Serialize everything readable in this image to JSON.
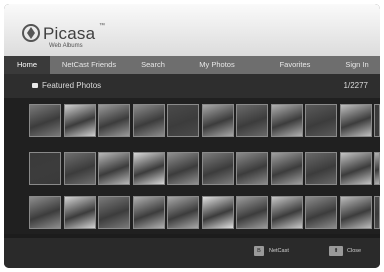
{
  "app": {
    "name": "Picasa",
    "trademark": "™",
    "subtitle": "Web Albums"
  },
  "nav": {
    "tabs": [
      {
        "id": "home",
        "label": "Home",
        "active": true
      },
      {
        "id": "netcast-friends",
        "label": "NetCast Friends",
        "active": false
      },
      {
        "id": "search",
        "label": "Search",
        "active": false
      },
      {
        "id": "my-photos",
        "label": "My Photos",
        "active": false
      },
      {
        "id": "favorites",
        "label": "Favorites",
        "active": false
      },
      {
        "id": "sign-in",
        "label": "Sign In",
        "active": false
      }
    ]
  },
  "section": {
    "title": "Featured Photos",
    "counter": "1/2277"
  },
  "footer": {
    "netcast_key": "B",
    "netcast_label": "NetCast",
    "close_key": "⬆",
    "close_label": "Close"
  },
  "photos": {
    "rows": [
      [
        {
          "name": "photo-wolf",
          "tone": "#7a7a7a"
        },
        {
          "name": "photo-leaf",
          "tone": "#d0d0d0"
        },
        {
          "name": "photo-hands",
          "tone": "#9a9a9a"
        },
        {
          "name": "photo-tree-silhouette",
          "tone": "#8c8c8c"
        },
        {
          "name": "photo-portrait-boy",
          "tone": "#4a4a4a"
        },
        {
          "name": "photo-pattern",
          "tone": "#a8a8a8"
        },
        {
          "name": "photo-flowers",
          "tone": "#6a6a6a"
        },
        {
          "name": "photo-landscape",
          "tone": "#b0b0b0"
        },
        {
          "name": "photo-forest",
          "tone": "#5a5a5a"
        },
        {
          "name": "photo-white-plant",
          "tone": "#c0c0c0"
        },
        {
          "name": "photo-edge-dark",
          "tone": "#3a3a3a"
        }
      ],
      [
        {
          "name": "photo-dark-wood",
          "tone": "#3a3a3a"
        },
        {
          "name": "photo-woman-portrait",
          "tone": "#6e6e6e"
        },
        {
          "name": "photo-beach",
          "tone": "#b8b8b8"
        },
        {
          "name": "photo-dancer",
          "tone": "#d8d8d8"
        },
        {
          "name": "photo-rocks",
          "tone": "#909090"
        },
        {
          "name": "photo-crowd",
          "tone": "#7c7c7c"
        },
        {
          "name": "photo-street",
          "tone": "#8a8a8a"
        },
        {
          "name": "photo-branches",
          "tone": "#a0a0a0"
        },
        {
          "name": "photo-grass",
          "tone": "#686868"
        },
        {
          "name": "photo-fog",
          "tone": "#c4c4c4"
        },
        {
          "name": "photo-edge-light",
          "tone": "#b4b4b4"
        }
      ],
      [
        {
          "name": "photo-gray-wall",
          "tone": "#8e8e8e"
        },
        {
          "name": "photo-snow-field",
          "tone": "#d4d4d4"
        },
        {
          "name": "photo-seal",
          "tone": "#7a7a7a"
        },
        {
          "name": "photo-animal",
          "tone": "#b0b0b0"
        },
        {
          "name": "photo-shore",
          "tone": "#a8a8a8"
        },
        {
          "name": "photo-wave",
          "tone": "#e0e0e0"
        },
        {
          "name": "photo-hills",
          "tone": "#9c9c9c"
        },
        {
          "name": "photo-tree-spiral",
          "tone": "#c8c8c8"
        },
        {
          "name": "photo-surf",
          "tone": "#8c8c8c"
        },
        {
          "name": "photo-mountain",
          "tone": "#bcbcbc"
        },
        {
          "name": "photo-edge-dark-2",
          "tone": "#4a4a4a"
        }
      ]
    ]
  }
}
